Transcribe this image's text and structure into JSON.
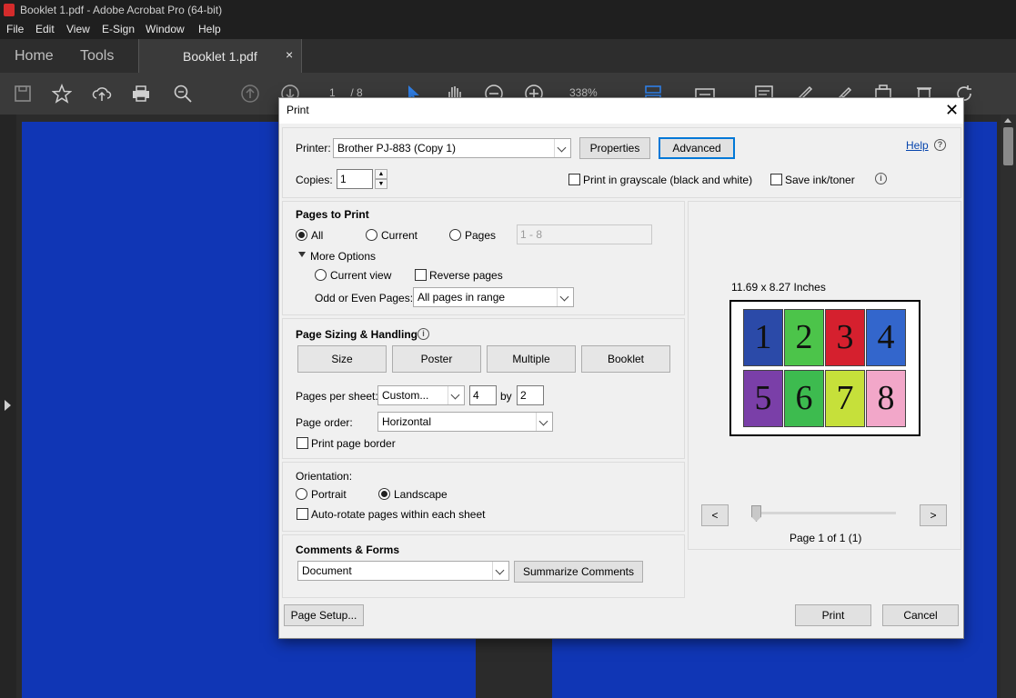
{
  "app": {
    "window_title": "Booklet 1.pdf - Adobe Acrobat Pro (64-bit)",
    "menu": [
      "File",
      "Edit",
      "View",
      "E-Sign",
      "Window",
      "Help"
    ],
    "tabs": {
      "home": "Home",
      "tools": "Tools",
      "document": "Booklet 1.pdf",
      "close": "×"
    },
    "toolbar": {
      "page_current": "1",
      "page_total": "/ 8",
      "zoom": "338%"
    }
  },
  "dialog": {
    "title": "Print",
    "close": "✕",
    "printer_label": "Printer:",
    "printer_value": "Brother PJ-883 (Copy 1)",
    "properties_button": "Properties",
    "advanced_button": "Advanced",
    "help_link": "Help",
    "copies_label": "Copies:",
    "copies_value": "1",
    "grayscale_label": "Print in grayscale (black and white)",
    "save_ink_label": "Save ink/toner",
    "pages_to_print": {
      "heading": "Pages to Print",
      "all": "All",
      "current": "Current",
      "pages": "Pages",
      "pages_range": "1 - 8",
      "more_options": "More Options",
      "current_view": "Current view",
      "reverse_pages": "Reverse pages",
      "odd_even_label": "Odd or Even Pages:",
      "odd_even_value": "All pages in range"
    },
    "sizing": {
      "heading": "Page Sizing & Handling",
      "size": "Size",
      "poster": "Poster",
      "multiple": "Multiple",
      "booklet": "Booklet",
      "pages_per_sheet_label": "Pages per sheet:",
      "pages_per_sheet_value": "Custom...",
      "cols": "4",
      "by": "by",
      "rows": "2",
      "page_order_label": "Page order:",
      "page_order_value": "Horizontal",
      "print_page_border": "Print page border"
    },
    "orientation": {
      "heading": "Orientation:",
      "portrait": "Portrait",
      "landscape": "Landscape",
      "auto_rotate": "Auto-rotate pages within each sheet"
    },
    "comments": {
      "heading": "Comments & Forms",
      "value": "Document",
      "summarize": "Summarize Comments"
    },
    "preview": {
      "size_text": "11.69 x 8.27 Inches",
      "pages": [
        {
          "n": "1",
          "color": "#2b4aa8"
        },
        {
          "n": "2",
          "color": "#4cc44a"
        },
        {
          "n": "3",
          "color": "#d5202e"
        },
        {
          "n": "4",
          "color": "#3366cc"
        },
        {
          "n": "5",
          "color": "#7a3fa8"
        },
        {
          "n": "6",
          "color": "#3dbb4f"
        },
        {
          "n": "7",
          "color": "#c6e03a"
        },
        {
          "n": "8",
          "color": "#f2a7c9"
        }
      ],
      "prev": "<",
      "next": ">",
      "page_of": "Page 1 of 1 (1)"
    },
    "page_setup_button": "Page Setup...",
    "print_button": "Print",
    "cancel_button": "Cancel"
  }
}
